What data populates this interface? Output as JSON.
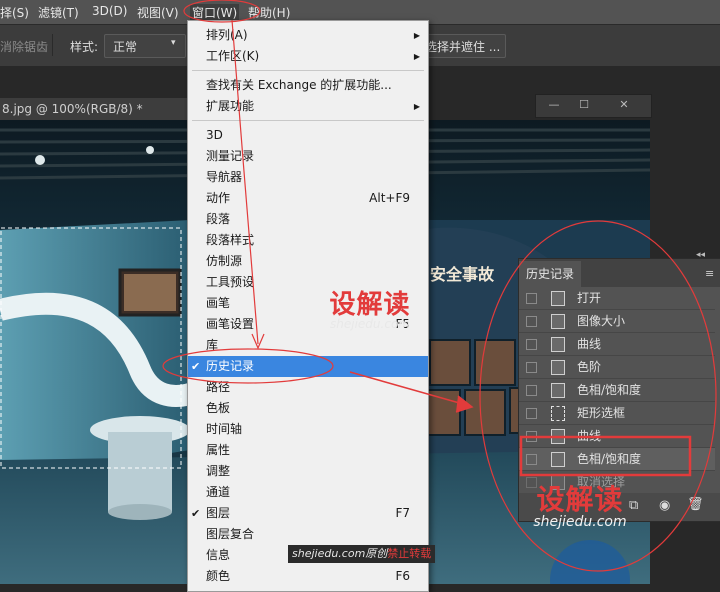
{
  "menubar": {
    "items": [
      "择(S)",
      "滤镜(T)",
      "3D(D)",
      "视图(V)",
      "窗口(W)",
      "帮助(H)"
    ]
  },
  "options_bar": {
    "feather_label": "消除锯齿",
    "style_label": "样式:",
    "style_value": "正常",
    "select_mask_label": "选择并遮住 ..."
  },
  "document": {
    "tab_title": "8.jpg @ 100%(RGB/8) *",
    "banner_text": "安全事故"
  },
  "window_menu": {
    "items": [
      {
        "label": "排列(A)",
        "shortcut": "",
        "submenu": true,
        "checked": false
      },
      {
        "label": "工作区(K)",
        "shortcut": "",
        "submenu": true,
        "checked": false
      },
      {
        "sep": true
      },
      {
        "label": "查找有关 Exchange 的扩展功能...",
        "shortcut": "",
        "submenu": false,
        "checked": false
      },
      {
        "label": "扩展功能",
        "shortcut": "",
        "submenu": true,
        "checked": false
      },
      {
        "sep": true
      },
      {
        "label": "3D",
        "shortcut": "",
        "submenu": false,
        "checked": false
      },
      {
        "label": "测量记录",
        "shortcut": "",
        "submenu": false,
        "checked": false
      },
      {
        "label": "导航器",
        "shortcut": "",
        "submenu": false,
        "checked": false
      },
      {
        "label": "动作",
        "shortcut": "Alt+F9",
        "submenu": false,
        "checked": false
      },
      {
        "label": "段落",
        "shortcut": "",
        "submenu": false,
        "checked": false
      },
      {
        "label": "段落样式",
        "shortcut": "",
        "submenu": false,
        "checked": false
      },
      {
        "label": "仿制源",
        "shortcut": "",
        "submenu": false,
        "checked": false
      },
      {
        "label": "工具预设",
        "shortcut": "",
        "submenu": false,
        "checked": false
      },
      {
        "label": "画笔",
        "shortcut": "",
        "submenu": false,
        "checked": false
      },
      {
        "label": "画笔设置",
        "shortcut": "F5",
        "submenu": false,
        "checked": false
      },
      {
        "label": "库",
        "shortcut": "",
        "submenu": false,
        "checked": false
      },
      {
        "label": "历史记录",
        "shortcut": "",
        "submenu": false,
        "checked": true,
        "highlighted": true
      },
      {
        "label": "路径",
        "shortcut": "",
        "submenu": false,
        "checked": false
      },
      {
        "label": "色板",
        "shortcut": "",
        "submenu": false,
        "checked": false
      },
      {
        "label": "时间轴",
        "shortcut": "",
        "submenu": false,
        "checked": false
      },
      {
        "label": "属性",
        "shortcut": "",
        "submenu": false,
        "checked": false
      },
      {
        "label": "调整",
        "shortcut": "",
        "submenu": false,
        "checked": false
      },
      {
        "label": "通道",
        "shortcut": "",
        "submenu": false,
        "checked": false
      },
      {
        "label": "图层",
        "shortcut": "F7",
        "submenu": false,
        "checked": true
      },
      {
        "label": "图层复合",
        "shortcut": "",
        "submenu": false,
        "checked": false
      },
      {
        "label": "信息",
        "shortcut": "",
        "submenu": false,
        "checked": false
      },
      {
        "label": "颜色",
        "shortcut": "F6",
        "submenu": false,
        "checked": false
      }
    ]
  },
  "history_panel": {
    "tab_label": "历史记录",
    "items": [
      {
        "label": "打开",
        "icon": "document-icon"
      },
      {
        "label": "图像大小",
        "icon": "document-icon"
      },
      {
        "label": "曲线",
        "icon": "document-icon"
      },
      {
        "label": "色阶",
        "icon": "document-icon"
      },
      {
        "label": "色相/饱和度",
        "icon": "document-icon"
      },
      {
        "label": "矩形选框",
        "icon": "marquee-icon"
      },
      {
        "label": "曲线",
        "icon": "document-icon"
      },
      {
        "label": "色相/饱和度",
        "icon": "document-icon"
      },
      {
        "label": "取消选择",
        "icon": "document-icon"
      }
    ]
  },
  "watermarks": {
    "logo_text": "设解读",
    "url_text": "shejiedu.com",
    "notice_prefix": "shejiedu.com原创",
    "notice_suffix": "禁止转载"
  },
  "colors": {
    "menu_highlight": "#3a86e0",
    "annotation_red": "#e23b3b",
    "panel_bg": "#535353"
  }
}
